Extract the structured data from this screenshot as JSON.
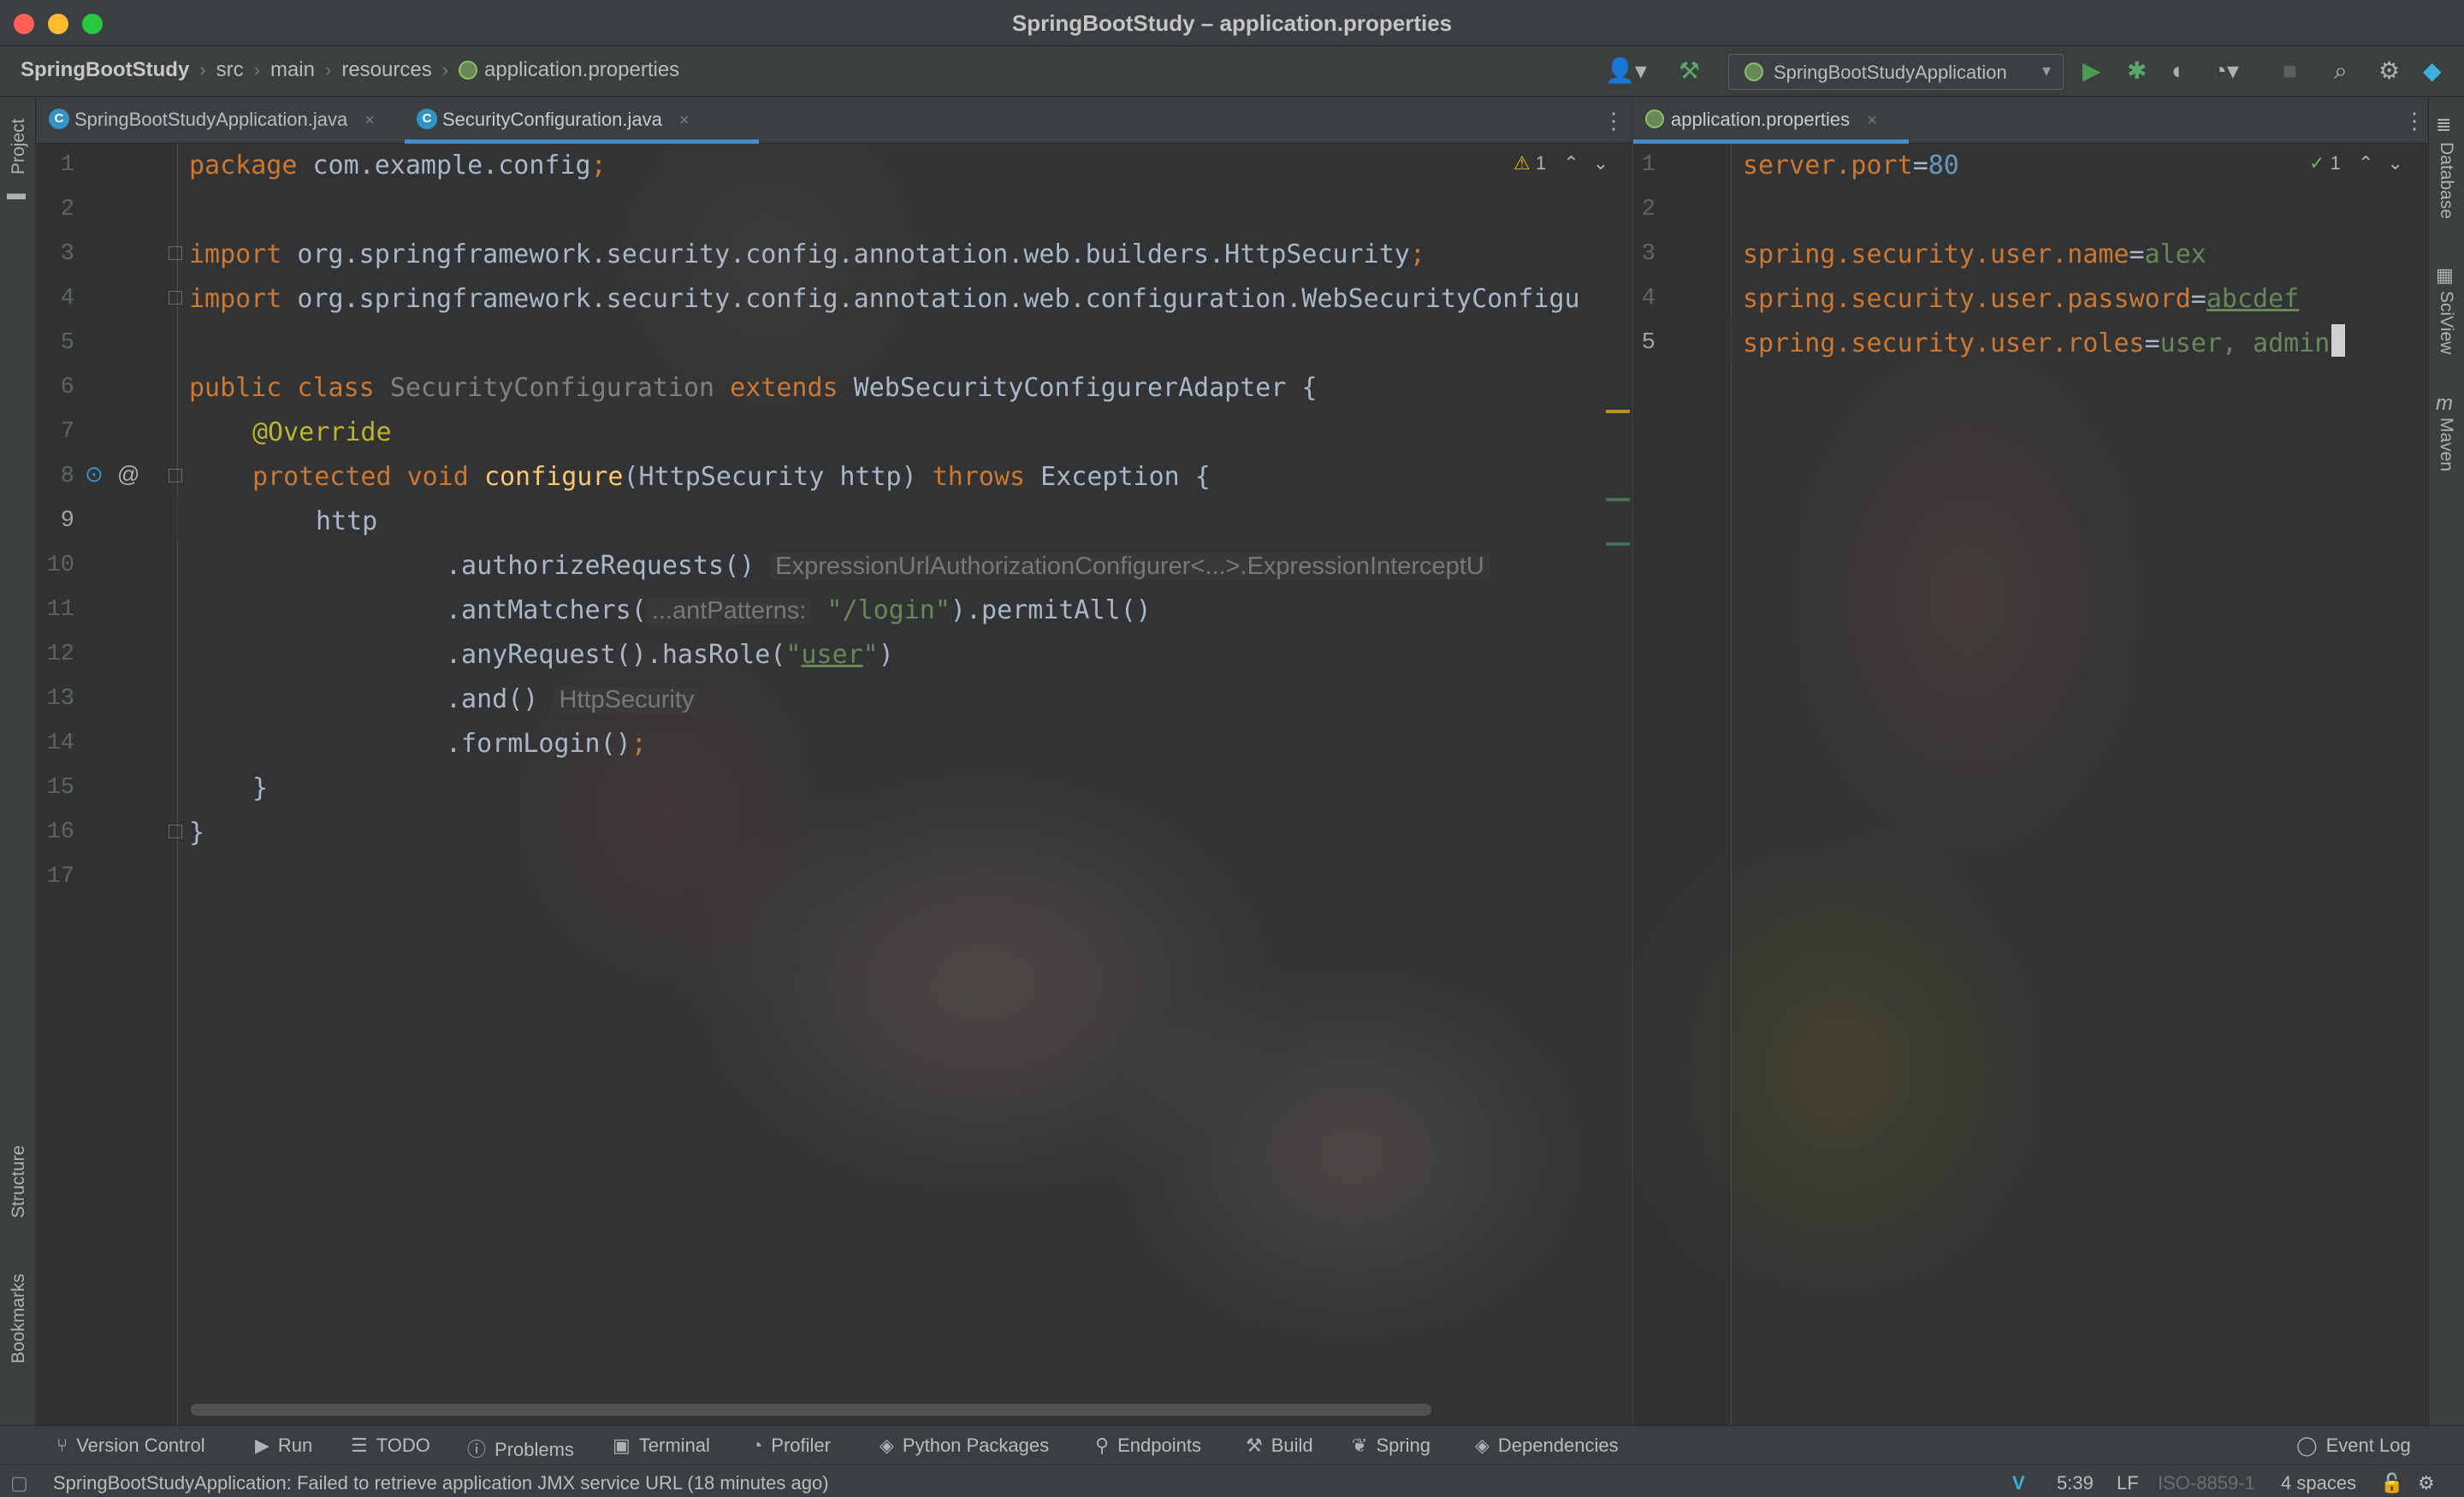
{
  "window": {
    "title": "SpringBootStudy – application.properties"
  },
  "breadcrumbs": [
    "SpringBootStudy",
    "src",
    "main",
    "resources",
    "application.properties"
  ],
  "run_config": {
    "label": "SpringBootStudyApplication"
  },
  "toolbar_icons": [
    "user-icon",
    "hammer-icon",
    "run-icon",
    "debug-icon",
    "coverage-icon",
    "profile-icon",
    "stop-icon",
    "search-icon",
    "gear-icon",
    "toolbox-icon"
  ],
  "left_strip": {
    "project": "Project",
    "structure": "Structure",
    "bookmarks": "Bookmarks"
  },
  "right_strip": {
    "database": "Database",
    "sciview": "SciView",
    "maven": "Maven"
  },
  "tabs_left": [
    {
      "label": "SpringBootStudyApplication.java",
      "active": false
    },
    {
      "label": "SecurityConfiguration.java",
      "active": true
    }
  ],
  "tabs_right": [
    {
      "label": "application.properties",
      "active": true
    }
  ],
  "left_editor": {
    "inspection": {
      "warnings": "1"
    },
    "line_numbers": [
      "1",
      "2",
      "3",
      "4",
      "5",
      "6",
      "7",
      "8",
      "9",
      "10",
      "11",
      "12",
      "13",
      "14",
      "15",
      "16",
      "17"
    ],
    "current_line": "9",
    "lines": {
      "l1_kw": "package",
      "l1_rest": " com.example.config",
      "l1_semi": ";",
      "l3_kw": "import",
      "l3_rest": " org.springframework.security.config.annotation.web.builders.HttpSecurity",
      "l3_semi": ";",
      "l4_kw": "import",
      "l4_rest": " org.springframework.security.config.annotation.web.configuration.WebSecurityConfigu",
      "l6_kw": "public class ",
      "l6_name": "SecurityConfiguration",
      "l6_ext": " extends ",
      "l6_rest": "WebSecurityConfigurerAdapter {",
      "l7_ann": "@Override",
      "l8_kw": "protected void ",
      "l8_fn": "configure",
      "l8_args": "(HttpSecurity http) ",
      "l8_throws": "throws",
      "l8_rest": " Exception {",
      "l9": "http",
      "l10": ".authorizeRequests()",
      "l10_hint": "ExpressionUrlAuthorizationConfigurer<...>.ExpressionInterceptU",
      "l11_a": ".antMatchers(",
      "l11_hint": "...antPatterns:",
      "l11_str": "\"/login\"",
      "l11_b": ").permitAll()",
      "l12_a": ".anyRequest().hasRole(",
      "l12_q1": "\"",
      "l12_str": "user",
      "l12_q2": "\"",
      "l12_b": ")",
      "l13": ".and()",
      "l13_hint": "HttpSecurity",
      "l14": ".formLogin()",
      "l14_semi": ";",
      "l15": "}",
      "l16": "}"
    }
  },
  "right_editor": {
    "inspection": {
      "ok": "1"
    },
    "line_numbers": [
      "1",
      "2",
      "3",
      "4",
      "5"
    ],
    "current_line": "5",
    "properties": [
      {
        "key": "server.port",
        "eq": "=",
        "value": "80"
      },
      {
        "key": "spring.security.user.name",
        "eq": "=",
        "value": "alex"
      },
      {
        "key": "spring.security.user.password",
        "eq": "=",
        "value": "abcdef"
      },
      {
        "key": "spring.security.user.roles",
        "eq": "=",
        "value": "user, admin"
      }
    ]
  },
  "tool_windows": [
    {
      "label": "Version Control",
      "icon": "branch-icon"
    },
    {
      "label": "Run",
      "icon": "run-icon"
    },
    {
      "label": "TODO",
      "icon": "list-icon"
    },
    {
      "label": "Problems",
      "icon": "info-icon"
    },
    {
      "label": "Terminal",
      "icon": "terminal-icon"
    },
    {
      "label": "Profiler",
      "icon": "profiler-icon"
    },
    {
      "label": "Python Packages",
      "icon": "layers-icon"
    },
    {
      "label": "Endpoints",
      "icon": "endpoints-icon"
    },
    {
      "label": "Build",
      "icon": "hammer-icon"
    },
    {
      "label": "Spring",
      "icon": "spring-icon"
    },
    {
      "label": "Dependencies",
      "icon": "layers-icon"
    }
  ],
  "event_log": "Event Log",
  "status": {
    "message": "SpringBootStudyApplication: Failed to retrieve application JMX service URL (18 minutes ago)",
    "position": "5:39",
    "line_sep": "LF",
    "encoding": "ISO-8859-1",
    "indent": "4 spaces"
  },
  "colors": {
    "accent": "#4a88c7",
    "keyword": "#cc7832",
    "string": "#6a8759",
    "number": "#6897bb",
    "annotation": "#bbb529",
    "function": "#ffc66d"
  }
}
